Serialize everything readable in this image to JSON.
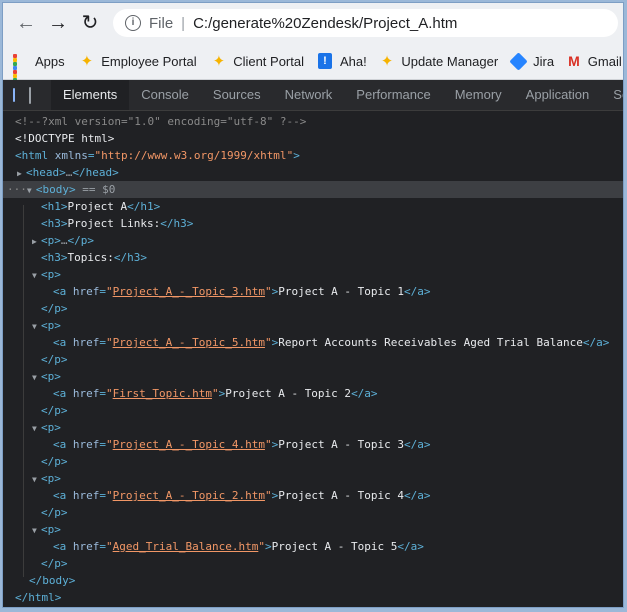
{
  "browser": {
    "scheme_label": "File",
    "url": "C:/generate%20Zendesk/Project_A.htm",
    "back_glyph": "←",
    "forward_glyph": "→",
    "reload_glyph": "↻"
  },
  "bookmarks": [
    {
      "label": "Apps",
      "icon": "apps-grid-icon"
    },
    {
      "label": "Employee Portal",
      "icon": "star-icon"
    },
    {
      "label": "Client Portal",
      "icon": "star-icon"
    },
    {
      "label": "Aha!",
      "icon": "aha-icon"
    },
    {
      "label": "Update Manager",
      "icon": "star-icon"
    },
    {
      "label": "Jira",
      "icon": "jira-icon"
    },
    {
      "label": "Gmail",
      "icon": "gmail-icon"
    }
  ],
  "devtools": {
    "tabs": [
      "Elements",
      "Console",
      "Sources",
      "Network",
      "Performance",
      "Memory",
      "Application",
      "Secu"
    ],
    "active_tab": "Elements"
  },
  "dom": {
    "xml_decl": "<!--?xml version=\"1.0\" encoding=\"utf-8\" ?-->",
    "doctype": "<!DOCTYPE html>",
    "html_xmlns": "http://www.w3.org/1999/xhtml",
    "head_ellipsis": "…",
    "body_selected_suffix": "== $0",
    "h1_text": "Project A",
    "h3_links": "Project Links:",
    "p_ellipsis": "…",
    "h3_topics": "Topics:",
    "links": [
      {
        "href": "Project_A_-_Topic_3.htm",
        "text": "Project A - Topic 1"
      },
      {
        "href": "Project_A_-_Topic_5.htm",
        "text": "Report Accounts Receivables Aged Trial Balance"
      },
      {
        "href": "First_Topic.htm",
        "text": "Project A - Topic 2"
      },
      {
        "href": "Project_A_-_Topic_4.htm",
        "text": "Project A - Topic 3"
      },
      {
        "href": "Project_A_-_Topic_2.htm",
        "text": "Project A - Topic 4"
      },
      {
        "href": "Aged_Trial_Balance.htm",
        "text": "Project A - Topic 5"
      }
    ]
  },
  "colors": {
    "tag": "#5db0d7",
    "attribute": "#9bbbdc",
    "value": "#f29766",
    "comment": "#898989",
    "background": "#202124"
  }
}
